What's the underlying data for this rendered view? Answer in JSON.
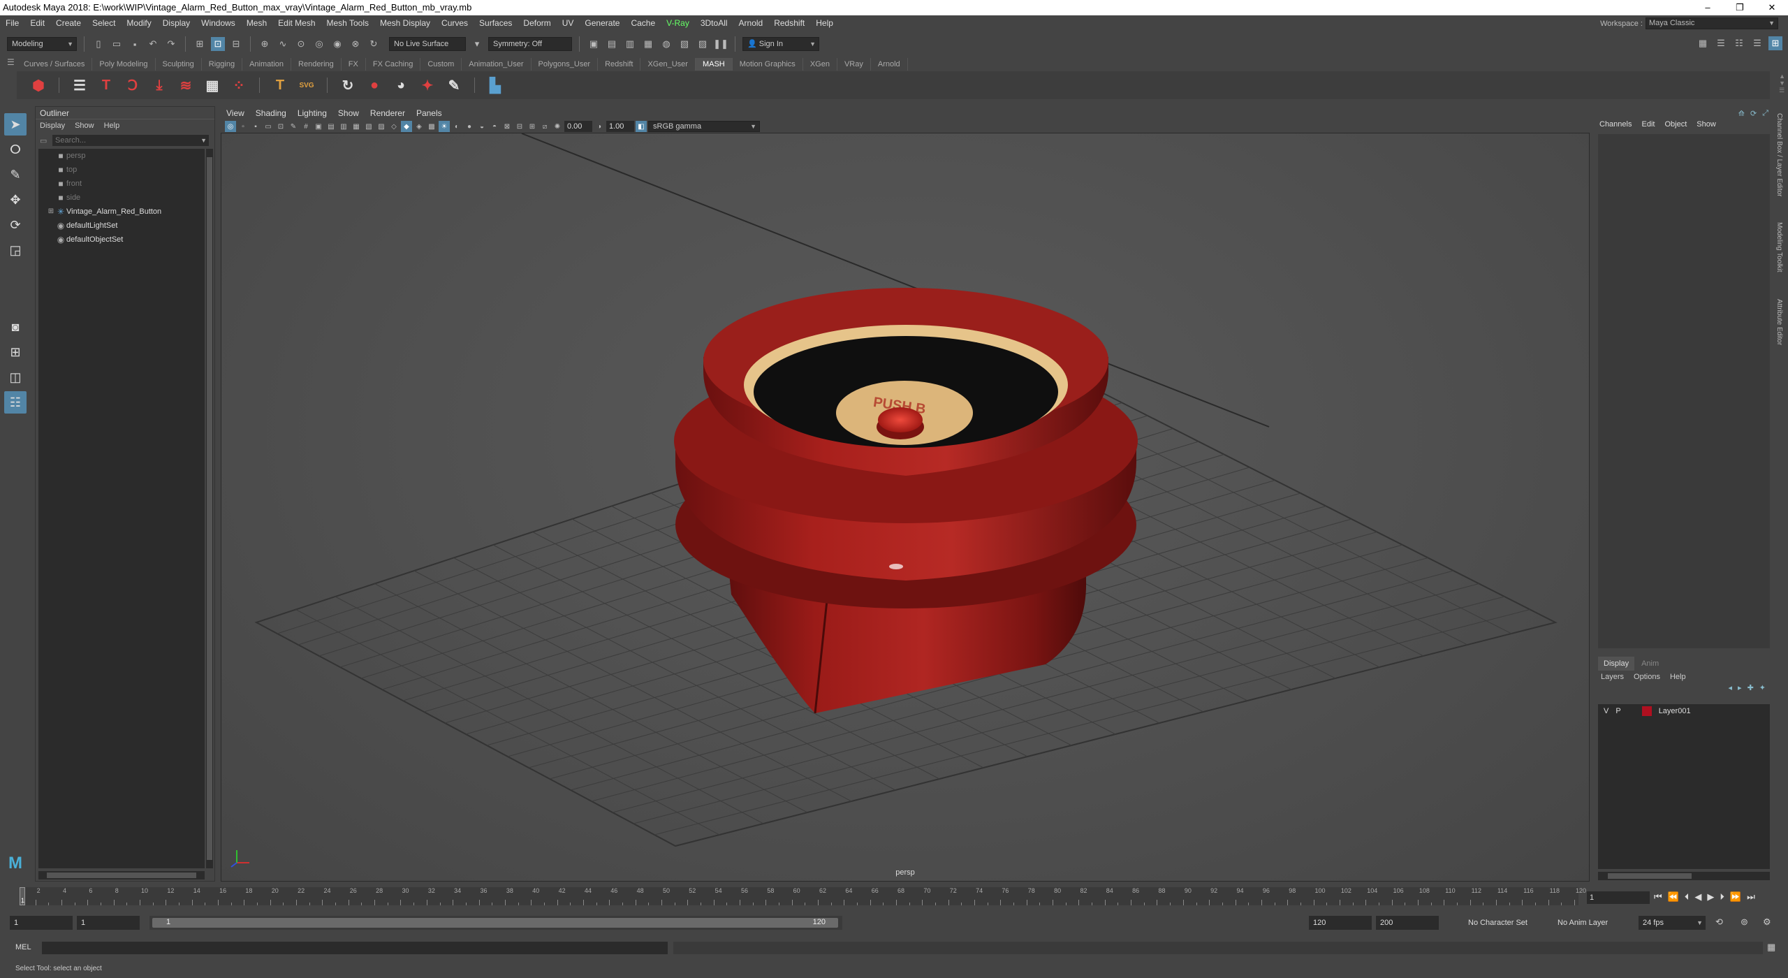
{
  "window": {
    "title": "Autodesk Maya 2018: E:\\work\\WIP\\Vintage_Alarm_Red_Button_max_vray\\Vintage_Alarm_Red_Button_mb_vray.mb",
    "minimize": "–",
    "restore": "❐",
    "close": "✕"
  },
  "menubar": {
    "items": [
      "File",
      "Edit",
      "Create",
      "Select",
      "Modify",
      "Display",
      "Windows",
      "Mesh",
      "Edit Mesh",
      "Mesh Tools",
      "Mesh Display",
      "Curves",
      "Surfaces",
      "Deform",
      "UV",
      "Generate",
      "Cache",
      "V-Ray",
      "3DtoAll",
      "Arnold",
      "Redshift",
      "Help"
    ],
    "workspace_label": "Workspace :",
    "workspace_value": "Maya Classic"
  },
  "statusline": {
    "mode": "Modeling",
    "live_surface": "No Live Surface",
    "symmetry": "Symmetry: Off",
    "sign_in": "Sign In"
  },
  "shelf": {
    "tabs": [
      "Curves / Surfaces",
      "Poly Modeling",
      "Sculpting",
      "Rigging",
      "Animation",
      "Rendering",
      "FX",
      "FX Caching",
      "Custom",
      "Animation_User",
      "Polygons_User",
      "Redshift",
      "XGen_User",
      "MASH",
      "Motion Graphics",
      "XGen",
      "VRay",
      "Arnold"
    ],
    "active_tab": "MASH"
  },
  "outliner": {
    "title": "Outliner",
    "menus": [
      "Display",
      "Show",
      "Help"
    ],
    "search_placeholder": "Search...",
    "items": [
      {
        "label": "persp",
        "dim": true
      },
      {
        "label": "top",
        "dim": true
      },
      {
        "label": "front",
        "dim": true
      },
      {
        "label": "side",
        "dim": true
      },
      {
        "label": "Vintage_Alarm_Red_Button",
        "dim": false
      },
      {
        "label": "defaultLightSet",
        "dim": false
      },
      {
        "label": "defaultObjectSet",
        "dim": false
      }
    ]
  },
  "viewport": {
    "menus": [
      "View",
      "Shading",
      "Lighting",
      "Show",
      "Renderer",
      "Panels"
    ],
    "exposure": "0.00",
    "gamma": "1.00",
    "color_space": "sRGB gamma",
    "camera_label": "persp",
    "button_text": "PUSH B"
  },
  "channelbox": {
    "menus": [
      "Channels",
      "Edit",
      "Object",
      "Show"
    ]
  },
  "sidetabs": [
    "Channel Box / Layer Editor",
    "Modeling Toolkit",
    "Attribute Editor"
  ],
  "layers": {
    "tabs": [
      "Display",
      "Anim"
    ],
    "menus": [
      "Layers",
      "Options",
      "Help"
    ],
    "row": {
      "v": "V",
      "p": "P",
      "name": "Layer001",
      "color": "#b01020"
    }
  },
  "timeline": {
    "ticks": [
      "2",
      "4",
      "6",
      "8",
      "10",
      "12",
      "14",
      "16",
      "18",
      "20",
      "22",
      "24",
      "26",
      "28",
      "30",
      "32",
      "34",
      "36",
      "38",
      "40",
      "42",
      "44",
      "46",
      "48",
      "50",
      "52",
      "54",
      "56",
      "58",
      "60",
      "62",
      "64",
      "66",
      "68",
      "70",
      "72",
      "74",
      "76",
      "78",
      "80",
      "82",
      "84",
      "86",
      "88",
      "90",
      "92",
      "94",
      "96",
      "98",
      "100",
      "102",
      "104",
      "106",
      "108",
      "110",
      "112",
      "114",
      "116",
      "118",
      "120"
    ],
    "current_frame": "1",
    "current_marker": "1"
  },
  "range": {
    "start": "1",
    "playback_start": "1",
    "bar_start": "1",
    "bar_end": "120",
    "playback_end": "120",
    "end": "200",
    "character_set": "No Character Set",
    "anim_layer": "No Anim Layer",
    "fps": "24 fps"
  },
  "cmdline": {
    "label": "MEL"
  },
  "help": {
    "text": "Select Tool: select an object"
  },
  "colors": {
    "accent": "#5285a6",
    "button_red": "#9c1a17"
  }
}
